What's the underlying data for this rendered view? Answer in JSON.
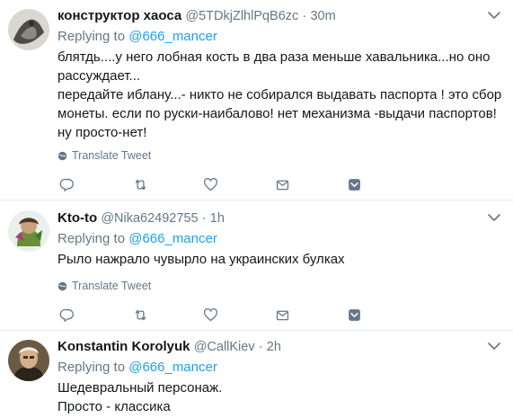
{
  "colors": {
    "link": "#1da1f2",
    "muted": "#657786",
    "text": "#14171a",
    "divider": "#e6ecf0"
  },
  "tweets": [
    {
      "fullname": "конструктор хаоса",
      "handle": "@5TDkjZlhlPqB6zc",
      "separator": "·",
      "time": "30m",
      "replying_prefix": "Replying to",
      "replying_to": "@666_mancer",
      "text": "блятдь....у него лобная кость в два раза меньше хавальника...но оно рассуждает...\nпередайте иблану...- никто не собирался выдавать паспорта ! это сбор монеты.  если по руски-наибалово! нет механизма -выдачи паспортов! ну просто-нет!",
      "translate_label": "Translate Tweet",
      "icons": [
        "reply-icon",
        "retweet-icon",
        "like-icon",
        "dm-icon",
        "add-to-moment-icon"
      ]
    },
    {
      "fullname": "Kto-to",
      "handle": "@Nika62492755",
      "separator": "·",
      "time": "1h",
      "replying_prefix": "Replying to",
      "replying_to": "@666_mancer",
      "text": "Рыло нажрало  чувырло на украинских булках",
      "translate_label": "Translate Tweet",
      "icons": [
        "reply-icon",
        "retweet-icon",
        "like-icon",
        "dm-icon",
        "add-to-moment-icon"
      ]
    },
    {
      "fullname": "Konstantin Korolyuk",
      "handle": "@CallKiev",
      "separator": "·",
      "time": "2h",
      "replying_prefix": "Replying to",
      "replying_to": "@666_mancer",
      "text": "Шедевральный персонаж.\nПросто - классика"
    }
  ]
}
